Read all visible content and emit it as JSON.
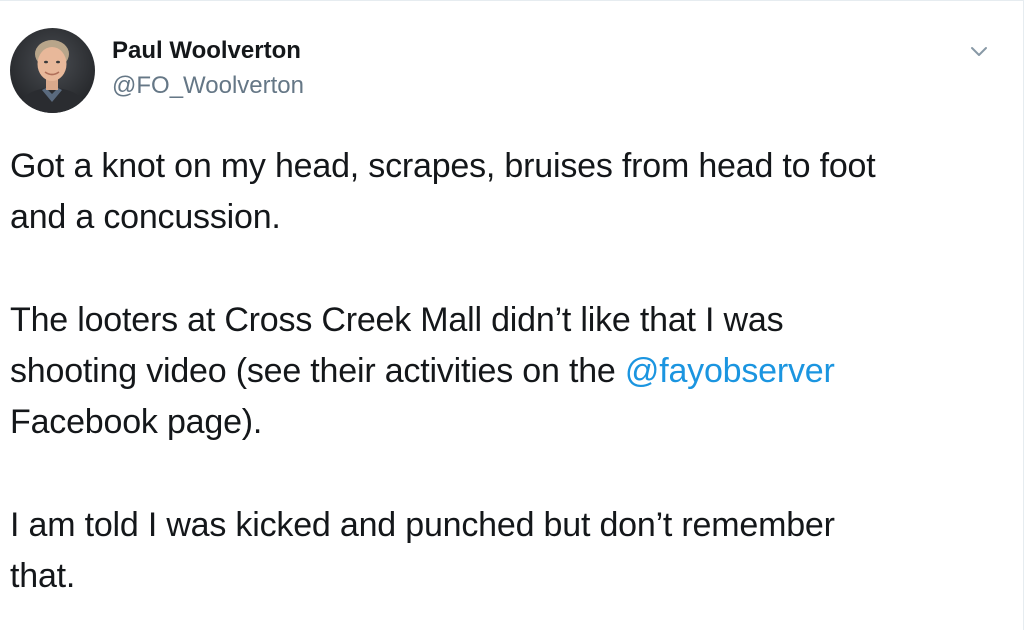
{
  "author": {
    "name": "Paul Woolverton",
    "handle": "@FO_Woolverton"
  },
  "menu": {
    "icon": "chevron-down-icon"
  },
  "tweet": {
    "p1": {
      "line1": "Got a knot on my head, scrapes, bruises from head to foot",
      "line2": "and a concussion."
    },
    "p2": {
      "line1": "The looters at Cross Creek Mall didn’t like that I was",
      "line2_before": "shooting video (see their activities on the ",
      "mention": "@fayobserver",
      "line3": "Facebook page)."
    },
    "p3": {
      "line1": "I am told I was kicked and punched but don’t remember",
      "line2": "that."
    }
  },
  "colors": {
    "text": "#14171a",
    "secondary": "#657786",
    "link": "#1b95e0",
    "border": "#e6ecf0"
  }
}
